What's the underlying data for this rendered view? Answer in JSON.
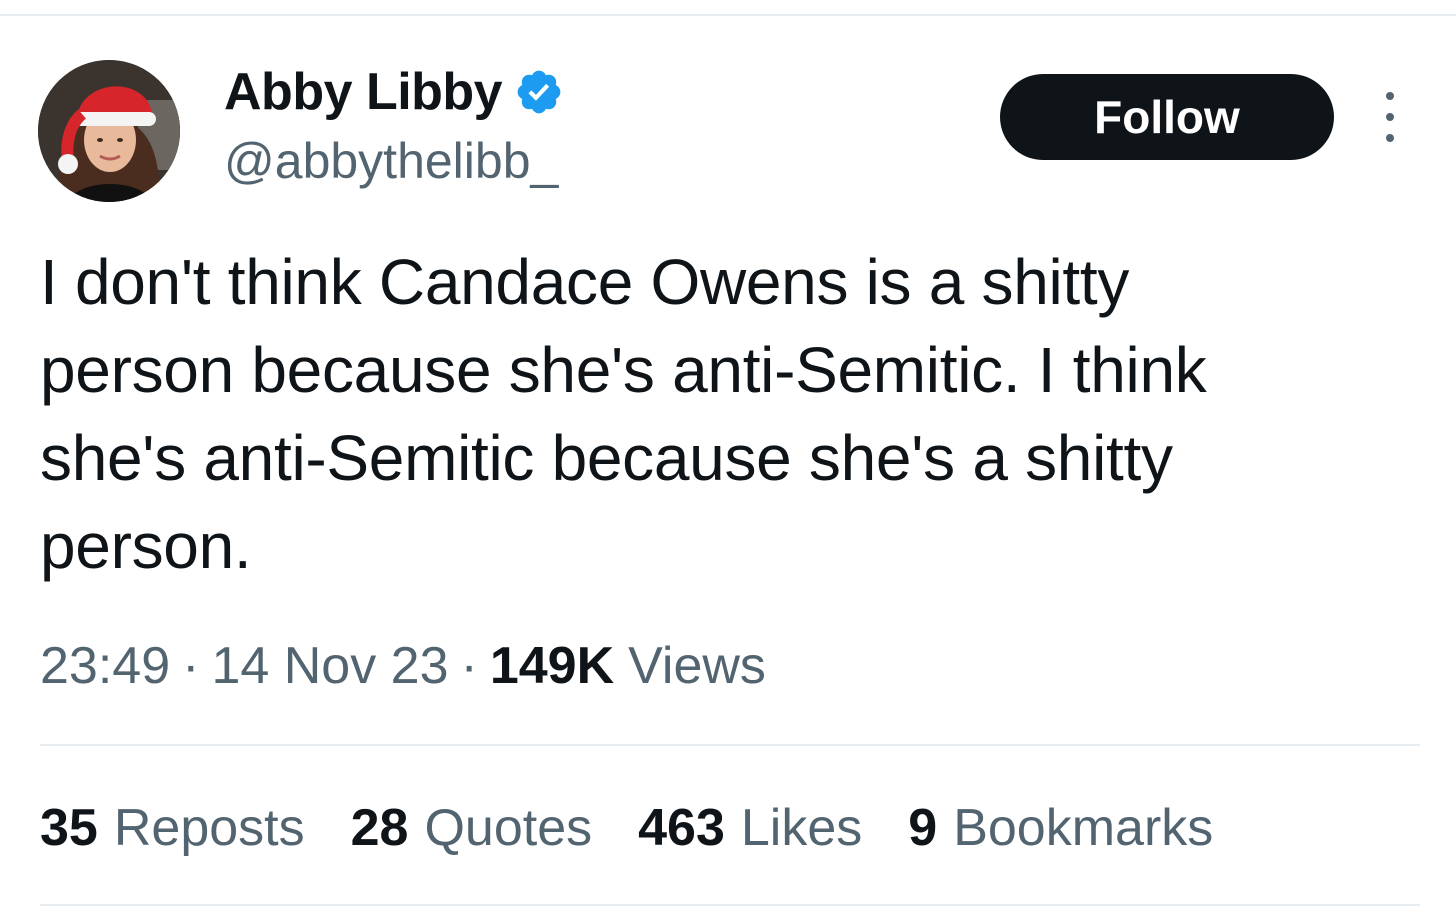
{
  "author": {
    "display_name": "Abby Libby",
    "handle": "@abbythelibb_",
    "verified_icon": "verified-badge-icon",
    "avatar_icon": "avatar-santa-hat"
  },
  "actions": {
    "follow_label": "Follow",
    "more_icon": "more-vertical-icon"
  },
  "tweet": {
    "lines": [
      "I don't think Candace Owens is a shitty",
      "person because she's anti-Semitic. I think",
      "she's anti-Semitic because she's a shitty",
      "person."
    ]
  },
  "meta": {
    "time": "23:49",
    "separator": "·",
    "date": "14 Nov 23",
    "views_count": "149K",
    "views_label": "Views"
  },
  "stats": [
    {
      "count": "35",
      "label": "Reposts"
    },
    {
      "count": "28",
      "label": "Quotes"
    },
    {
      "count": "463",
      "label": "Likes"
    },
    {
      "count": "9",
      "label": "Bookmarks"
    }
  ],
  "colors": {
    "text_primary": "#0f1419",
    "text_secondary": "#536471",
    "verified_blue": "#1d9bf0",
    "divider": "#e6ecf0",
    "santa_red": "#d6262b"
  }
}
